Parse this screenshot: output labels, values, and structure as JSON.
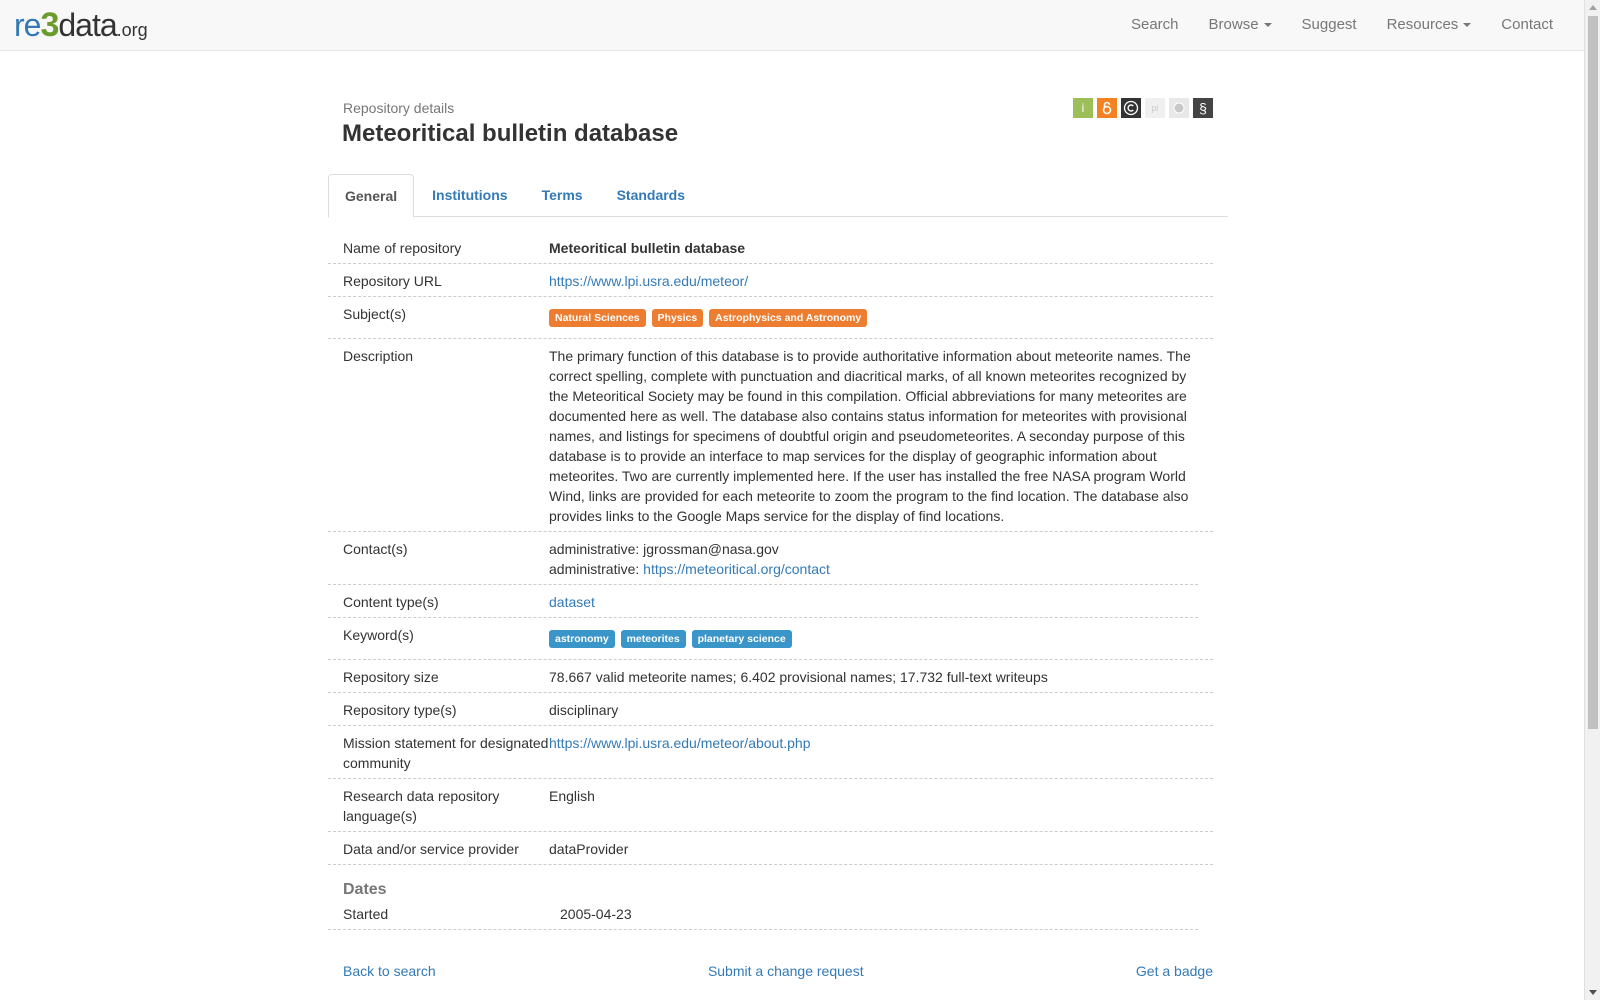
{
  "navbar": {
    "logo": {
      "re": "re",
      "three": "3",
      "data": "data",
      "org": ".org"
    },
    "items": [
      {
        "label": "Search",
        "dropdown": false
      },
      {
        "label": "Browse",
        "dropdown": true
      },
      {
        "label": "Suggest",
        "dropdown": false
      },
      {
        "label": "Resources",
        "dropdown": true
      },
      {
        "label": "Contact",
        "dropdown": false
      }
    ]
  },
  "header": {
    "subheading": "Repository details",
    "title": "Meteoritical bulletin database",
    "badges": [
      {
        "name": "info-icon",
        "glyph": "i",
        "color": "#9cbf5a"
      },
      {
        "name": "open-access-icon",
        "glyph": "ʘ",
        "color": "#f58220"
      },
      {
        "name": "copyright-icon",
        "glyph": "©",
        "color": "#333333"
      },
      {
        "name": "pid-icon",
        "glyph": "pi",
        "color": "#f0f0f0"
      },
      {
        "name": "certificate-icon",
        "glyph": "✺",
        "color": "#e8e8e8"
      },
      {
        "name": "policy-icon",
        "glyph": "§",
        "color": "#444444"
      }
    ]
  },
  "tabs": [
    {
      "label": "General",
      "active": true
    },
    {
      "label": "Institutions",
      "active": false
    },
    {
      "label": "Terms",
      "active": false
    },
    {
      "label": "Standards",
      "active": false
    }
  ],
  "details": {
    "name_label": "Name of repository",
    "name_value": "Meteoritical bulletin database",
    "url_label": "Repository URL",
    "url_value": "https://www.lpi.usra.edu/meteor/",
    "subjects_label": "Subject(s)",
    "subjects": [
      "Natural Sciences",
      "Physics",
      "Astrophysics and Astronomy"
    ],
    "description_label": "Description",
    "description": "The primary function of this database is to provide authoritative information about meteorite names. The correct spelling, complete with punctuation and diacritical marks, of all known meteorites recognized by the Meteoritical Society may be found in this compilation. Official abbreviations for many meteorites are documented here as well. The database also contains status information for meteorites with provisional names, and listings for specimens of doubtful origin and pseudometeorites. A seconday purpose of this database is to provide an interface to map services for the display of geographic information about meteorites. Two are currently implemented here. If the user has installed the free NASA program World Wind, links are provided for each meteorite to zoom the program to the find location. The database also provides links to the Google Maps service for the display of find locations.",
    "contacts_label": "Contact(s)",
    "contact_1_prefix": "administrative: ",
    "contact_1_value": "jgrossman@nasa.gov",
    "contact_2_prefix": "administrative: ",
    "contact_2_link": "https://meteoritical.org/contact",
    "content_type_label": "Content type(s)",
    "content_type_value": "dataset",
    "keywords_label": "Keyword(s)",
    "keywords": [
      "astronomy",
      "meteorites",
      "planetary science"
    ],
    "size_label": "Repository size",
    "size_value": "78.667 valid meteorite names; 6.402 provisional names; 17.732 full-text writeups",
    "type_label": "Repository type(s)",
    "type_value": "disciplinary",
    "mission_label": "Mission statement for designated community",
    "mission_value": "https://www.lpi.usra.edu/meteor/about.php",
    "language_label": "Research data repository language(s)",
    "language_value": "English",
    "provider_label": "Data and/or service provider",
    "provider_value": "dataProvider"
  },
  "dates": {
    "title": "Dates",
    "started_label": "Started",
    "started_value": "2005-04-23"
  },
  "footer": {
    "back": "Back to search",
    "submit": "Submit a change request",
    "badge": "Get a badge"
  }
}
